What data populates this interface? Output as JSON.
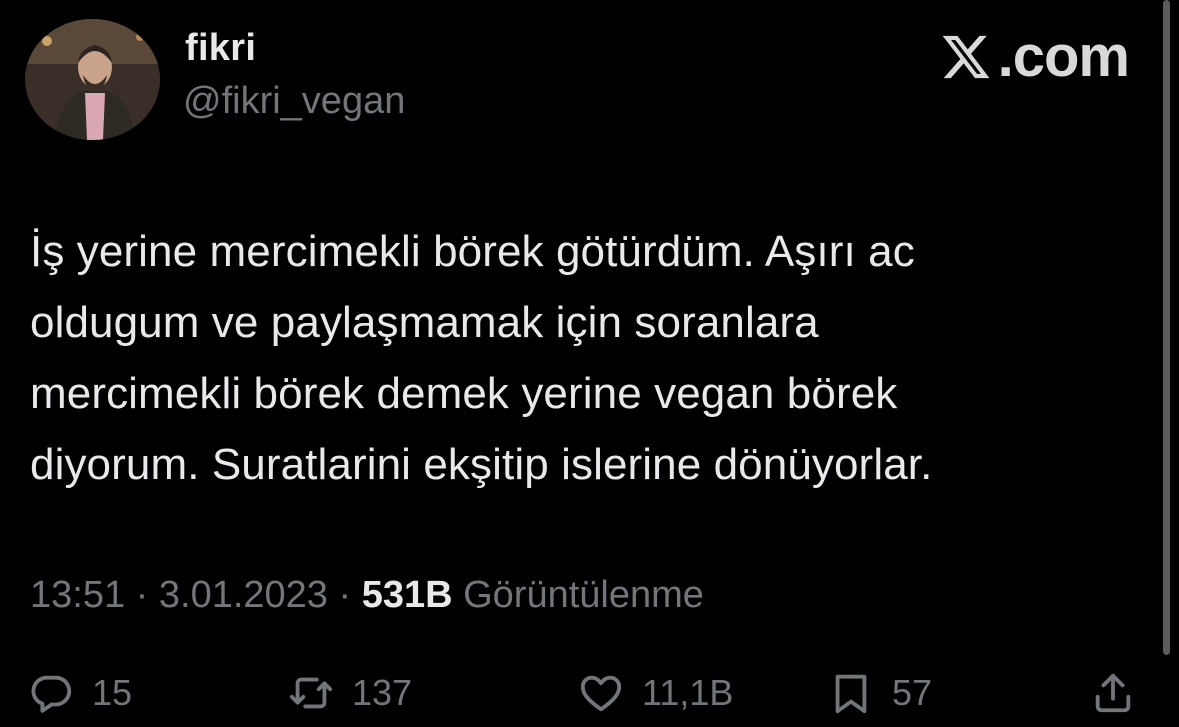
{
  "brand": {
    "text": ".com",
    "icon": "x-logo-icon"
  },
  "author": {
    "display_name": "fikri",
    "handle": "@fikri_vegan",
    "avatar": "avatar-photo"
  },
  "tweet": {
    "text": "İş yerine mercimekli börek götürdüm. Aşırı ac\noldugum ve paylaşmamak için soranlara\nmercimekli börek demek yerine vegan börek\ndiyorum. Suratlarini ekşitip islerine dönüyorlar."
  },
  "meta": {
    "time": "13:51",
    "separator": " · ",
    "date": "3.01.2023",
    "views_count": "531B",
    "views_label": " Görüntülenme"
  },
  "actions": {
    "replies": {
      "icon": "reply-icon",
      "count": "15"
    },
    "retweets": {
      "icon": "retweet-icon",
      "count": "137"
    },
    "likes": {
      "icon": "like-icon",
      "count": "11,1B"
    },
    "bookmarks": {
      "icon": "bookmark-icon",
      "count": "57"
    },
    "share": {
      "icon": "share-icon"
    }
  },
  "colors": {
    "background": "#000000",
    "primary_text": "#e7e9ea",
    "secondary_text": "#71767b"
  }
}
